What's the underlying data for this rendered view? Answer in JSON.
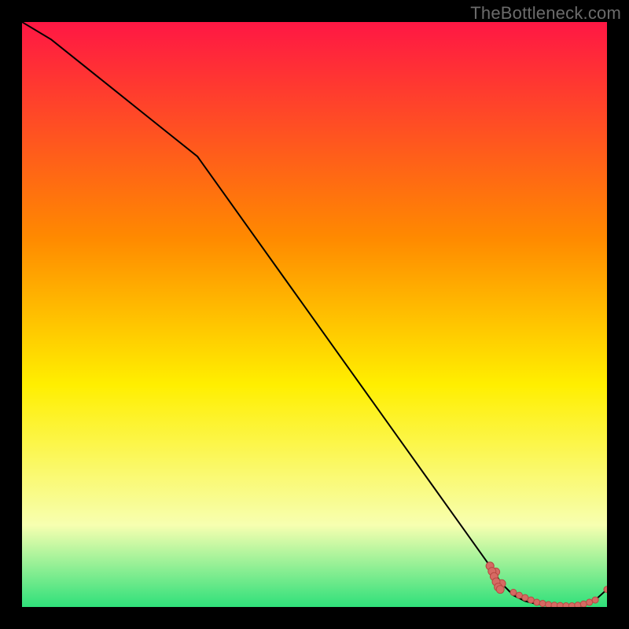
{
  "watermark": "TheBottleneck.com",
  "colors": {
    "background": "#000000",
    "line": "#000000",
    "marker_fill": "#d66a63",
    "marker_stroke": "#b74a43"
  },
  "chart_data": {
    "type": "line",
    "title": "",
    "xlabel": "",
    "ylabel": "",
    "xlim": [
      0,
      100
    ],
    "ylim": [
      0,
      100
    ],
    "grid": false,
    "legend": false,
    "background_gradient": [
      "#ff1744",
      "#ff8a00",
      "#ffef00",
      "#f7ffb0",
      "#2fe07a"
    ],
    "series": [
      {
        "name": "main-curve",
        "x": [
          0,
          5,
          10,
          15,
          20,
          25,
          30,
          35,
          40,
          45,
          50,
          55,
          60,
          65,
          70,
          75,
          80,
          82,
          84,
          86,
          88,
          90,
          92,
          94,
          96,
          98,
          100
        ],
        "y": [
          100,
          97,
          93,
          89,
          85,
          81,
          77,
          70,
          63,
          56,
          49,
          42,
          35,
          28,
          21,
          14,
          7,
          4,
          2,
          1,
          0.5,
          0.3,
          0.2,
          0.2,
          0.5,
          1.2,
          3
        ]
      }
    ],
    "marker_series": {
      "name": "bottom-markers",
      "x": [
        80,
        81,
        82,
        84,
        85,
        86,
        87,
        88,
        89,
        90,
        91,
        92,
        93,
        94,
        95,
        96,
        97,
        98,
        100
      ],
      "y": [
        7,
        6,
        4,
        2.5,
        2,
        1.6,
        1.2,
        0.8,
        0.6,
        0.4,
        0.3,
        0.25,
        0.2,
        0.2,
        0.3,
        0.5,
        0.8,
        1.2,
        3
      ]
    }
  }
}
